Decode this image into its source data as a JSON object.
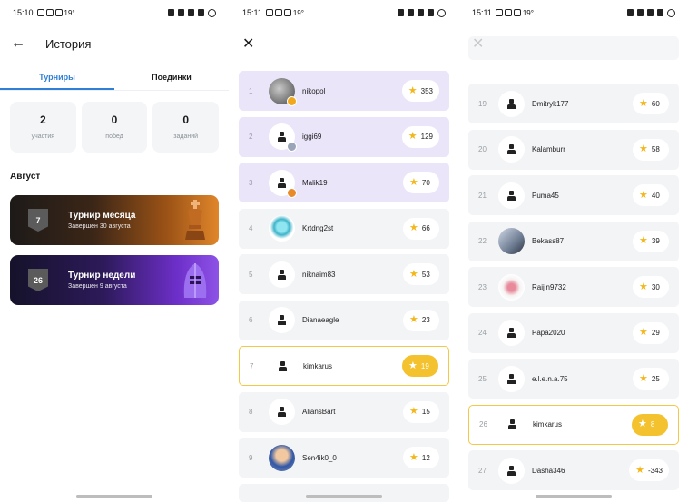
{
  "status_bar": {
    "time1": "15:10",
    "time2": "15:11",
    "time3": "15:11",
    "temp": "19°"
  },
  "history": {
    "title": "История",
    "tabs": [
      "Турниры",
      "Поединки"
    ],
    "stats": [
      {
        "value": "2",
        "label": "участия"
      },
      {
        "value": "0",
        "label": "побед"
      },
      {
        "value": "0",
        "label": "заданий"
      }
    ],
    "month": "Август",
    "tournaments": [
      {
        "badge": "7",
        "name": "Турнир месяца",
        "subtitle": "Завершен 30 августа"
      },
      {
        "badge": "26",
        "name": "Турнир недели",
        "subtitle": "Завершен 9 августа"
      }
    ]
  },
  "leaderboard1": [
    {
      "rank": "1",
      "user": "nikopol",
      "score": "353",
      "avatar": "photo4",
      "medal": "gold"
    },
    {
      "rank": "2",
      "user": "iggi69",
      "score": "129",
      "avatar": "default",
      "medal": "silver"
    },
    {
      "rank": "3",
      "user": "Malik19",
      "score": "70",
      "avatar": "default",
      "medal": "bronze"
    },
    {
      "rank": "4",
      "user": "Krtdng2st",
      "score": "66",
      "avatar": "diamond"
    },
    {
      "rank": "5",
      "user": "niknaim83",
      "score": "53",
      "avatar": "default"
    },
    {
      "rank": "6",
      "user": "Dianaeagle",
      "score": "23",
      "avatar": "default"
    },
    {
      "rank": "7",
      "user": "kimkarus",
      "score": "19",
      "avatar": "default",
      "me": true
    },
    {
      "rank": "8",
      "user": "AliansBart",
      "score": "15",
      "avatar": "default"
    },
    {
      "rank": "9",
      "user": "Sen4ik0_0",
      "score": "12",
      "avatar": "photo2"
    }
  ],
  "leaderboard2": [
    {
      "rank": "19",
      "user": "Dmitryk177",
      "score": "60",
      "avatar": "default"
    },
    {
      "rank": "20",
      "user": "Kalamburr",
      "score": "58",
      "avatar": "default"
    },
    {
      "rank": "21",
      "user": "Puma45",
      "score": "40",
      "avatar": "default"
    },
    {
      "rank": "22",
      "user": "Bekass87",
      "score": "39",
      "avatar": "photo3"
    },
    {
      "rank": "23",
      "user": "Raijin9732",
      "score": "30",
      "avatar": "flower"
    },
    {
      "rank": "24",
      "user": "Papa2020",
      "score": "29",
      "avatar": "default"
    },
    {
      "rank": "25",
      "user": "e.l.e.n.a.75",
      "score": "25",
      "avatar": "default"
    },
    {
      "rank": "26",
      "user": "kimkarus",
      "score": "8",
      "avatar": "default",
      "me": true
    },
    {
      "rank": "27",
      "user": "Dasha346",
      "score": "-343",
      "avatar": "default"
    }
  ],
  "colors": {
    "accent": "#2f7fd6",
    "highlight": "#f3c22e",
    "top_row": "#ebe5fa",
    "gold": "#f2a81c",
    "silver": "#9aa6b8",
    "bronze": "#e8892a"
  }
}
